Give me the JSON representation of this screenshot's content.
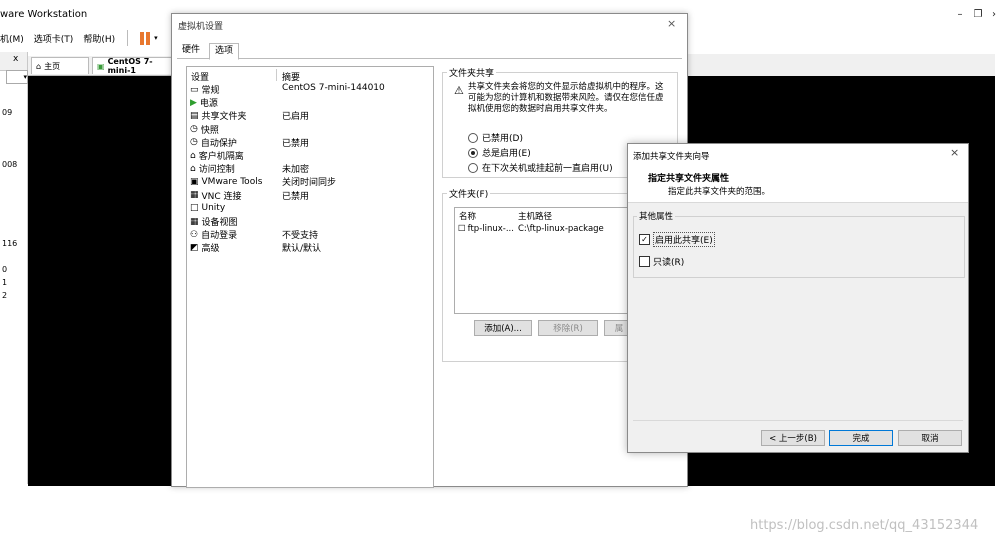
{
  "app": {
    "title": "ware Workstation",
    "menu": [
      "机(M)",
      "选项卡(T)",
      "帮助(H)"
    ],
    "window_controls": {
      "minimize": "–",
      "restore": "❐",
      "more": "›"
    },
    "library_close": "x",
    "library_numbers": [
      "09",
      "008",
      "116",
      "0",
      "1",
      "2"
    ],
    "tabs": {
      "home": "主页",
      "vm": "CentOS 7-mini-1"
    }
  },
  "settings": {
    "title": "虚拟机设置",
    "close": "×",
    "tabs": [
      "硬件",
      "选项"
    ],
    "device_list": {
      "headers": [
        "设置",
        "摘要"
      ],
      "rows": [
        {
          "name": "常规",
          "summary": "CentOS 7-mini-144010"
        },
        {
          "name": "电源",
          "summary": ""
        },
        {
          "name": "共享文件夹",
          "summary": "已启用"
        },
        {
          "name": "快照",
          "summary": ""
        },
        {
          "name": "自动保护",
          "summary": "已禁用"
        },
        {
          "name": "客户机隔离",
          "summary": ""
        },
        {
          "name": "访问控制",
          "summary": "未加密"
        },
        {
          "name": "VMware Tools",
          "summary": "关闭时间同步"
        },
        {
          "name": "VNC 连接",
          "summary": "已禁用"
        },
        {
          "name": "Unity",
          "summary": ""
        },
        {
          "name": "设备视图",
          "summary": ""
        },
        {
          "name": "自动登录",
          "summary": "不受支持"
        },
        {
          "name": "高级",
          "summary": "默认/默认"
        }
      ]
    },
    "share": {
      "legend": "文件夹共享",
      "description": "共享文件夹会将您的文件显示给虚拟机中的程序。这可能为您的计算机和数据带来风险。请仅在您信任虚拟机使用您的数据时启用共享文件夹。",
      "options": [
        {
          "label": "已禁用(D)",
          "selected": false
        },
        {
          "label": "总是启用(E)",
          "selected": true
        },
        {
          "label": "在下次关机或挂起前一直启用(U)",
          "selected": false
        }
      ]
    },
    "folders": {
      "legend": "文件夹(F)",
      "headers": [
        "名称",
        "主机路径"
      ],
      "items": [
        {
          "name": "ftp-linux-...",
          "path": "C:\\ftp-linux-package"
        }
      ],
      "buttons": {
        "add": "添加(A)...",
        "remove": "移除(R)",
        "properties": "属"
      }
    }
  },
  "wizard": {
    "title": "添加共享文件夹向导",
    "close": "×",
    "heading": "指定共享文件夹属性",
    "subheading": "指定此共享文件夹的范围。",
    "group_legend": "其他属性",
    "options": [
      {
        "label": "启用此共享(E)",
        "checked": true
      },
      {
        "label": "只读(R)",
        "checked": false
      }
    ],
    "buttons": {
      "back": "< 上一步(B)",
      "finish": "完成",
      "cancel": "取消"
    }
  },
  "watermark": "https://blog.csdn.net/qq_43152344"
}
